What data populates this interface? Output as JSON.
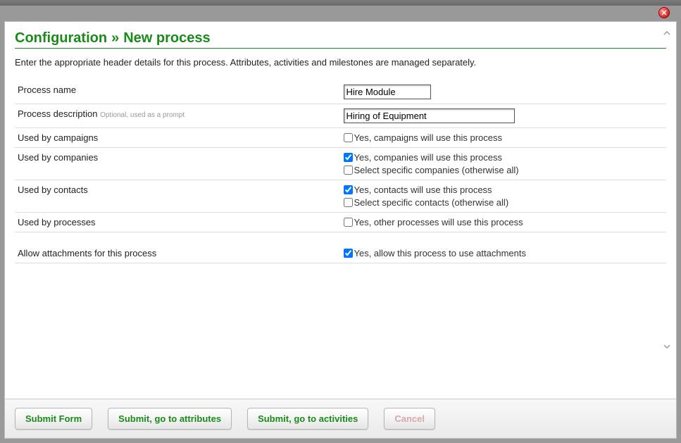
{
  "header": {
    "breadcrumb_root": "Configuration",
    "breadcrumb_sep": "»",
    "page_title": "New process"
  },
  "intro_text": "Enter the appropriate header details for this process. Attributes, activities and milestones are managed separately.",
  "fields": {
    "process_name": {
      "label": "Process name",
      "value": "Hire Module"
    },
    "process_description": {
      "label": "Process description",
      "hint": "Optional, used as a prompt",
      "value": "Hiring of Equipment"
    },
    "used_by_campaigns": {
      "label": "Used by campaigns",
      "check1_label": "Yes, campaigns will use this process",
      "check1_checked": false
    },
    "used_by_companies": {
      "label": "Used by companies",
      "check1_label": "Yes, companies will use this process",
      "check1_checked": true,
      "check2_label": "Select specific companies (otherwise all)",
      "check2_checked": false
    },
    "used_by_contacts": {
      "label": "Used by contacts",
      "check1_label": "Yes, contacts will use this process",
      "check1_checked": true,
      "check2_label": "Select specific contacts (otherwise all)",
      "check2_checked": false
    },
    "used_by_processes": {
      "label": "Used by processes",
      "check1_label": "Yes, other processes will use this process",
      "check1_checked": false
    },
    "allow_attachments": {
      "label": "Allow attachments for this process",
      "check1_label": "Yes, allow this process to use attachments",
      "check1_checked": true
    }
  },
  "buttons": {
    "submit_form": "Submit Form",
    "submit_attributes": "Submit, go to attributes",
    "submit_activities": "Submit, go to activities",
    "cancel": "Cancel"
  }
}
